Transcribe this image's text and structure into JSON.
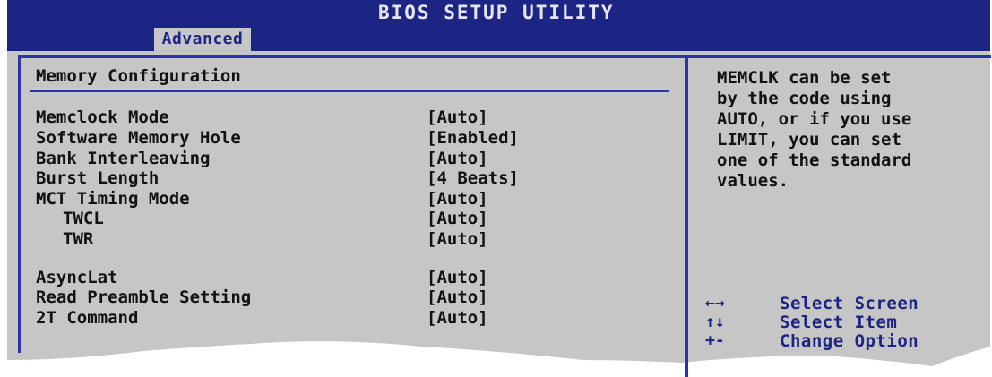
{
  "header": {
    "title": "BIOS SETUP UTILITY",
    "tab": "Advanced"
  },
  "main": {
    "title": "Memory Configuration",
    "settings": [
      {
        "label": "Memclock Mode",
        "value": "[Auto]"
      },
      {
        "label": "Software Memory Hole",
        "value": "[Enabled]"
      },
      {
        "label": "Bank Interleaving",
        "value": "[Auto]"
      },
      {
        "label": "Burst Length",
        "value": "[4 Beats]"
      },
      {
        "label": "MCT Timing Mode",
        "value": "[Auto]"
      },
      {
        "label": "TWCL",
        "value": "[Auto]"
      },
      {
        "label": "TWR",
        "value": "[Auto]"
      },
      {
        "label": "AsyncLat",
        "value": "[Auto]"
      },
      {
        "label": "Read Preamble Setting",
        "value": "[Auto]"
      },
      {
        "label": "2T Command",
        "value": "[Auto]"
      }
    ]
  },
  "help": {
    "text": "MEMCLK can be set\nby the code using\nAUTO, or if you use\nLIMIT, you can set\none of the standard\nvalues."
  },
  "keys": [
    {
      "symbol": "←→",
      "action": "Select Screen"
    },
    {
      "symbol": "↑↓",
      "action": "Select Item"
    },
    {
      "symbol": "+-",
      "action": "Change Option"
    }
  ],
  "colors": {
    "header_bg": "#1c2584",
    "body_bg": "#c6c6c6",
    "border": "#2c32a8",
    "text": "#121212",
    "key_text": "#1c2584"
  }
}
